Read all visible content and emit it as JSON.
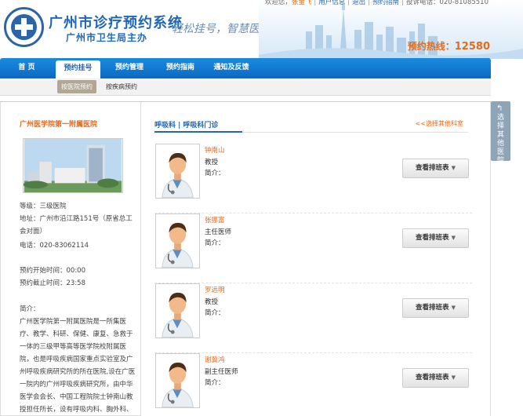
{
  "header": {
    "site_title": "广州市诊疗预约系统",
    "site_subtitle": "广州市卫生局主办",
    "slogan": "轻松挂号，智慧医疗",
    "welcome_prefix": "欢迎您，",
    "user_name": "张金飞",
    "links": [
      "用户信息",
      "退出",
      "预约指南"
    ],
    "complaint_phone": "投诉电话：020-81085510",
    "hotline_label": "预约热线：",
    "hotline_number": "12580"
  },
  "nav": {
    "items": [
      "首 页",
      "预约挂号",
      "预约管理",
      "预约指南",
      "通知及反馈"
    ],
    "active_index": 1
  },
  "subnav": {
    "items": [
      "按医院预约",
      "按疾病预约"
    ],
    "active_index": 0
  },
  "hospital": {
    "name": "广州医学院第一附属医院",
    "grade": "等级：三级医院",
    "address_line1": "地址：广州市沿江路151号（原省总工",
    "address_line2": "会对面）",
    "phone": "电话：020-83062114",
    "open_time": "预约开始时间：00:00",
    "close_time": "预约截止时间：23:58",
    "intro_label": "简介：",
    "intro_text": "广州医学院第一附属医院是一所集医疗、教学、科研、保健、康复、急救于一体的三级甲等高等医学院校附属医院，也是呼吸疾病国家重点实验室及广州呼吸疾病研究所的所在医院,设在广医一院内的广州呼吸疾病研究所，由中华医学会会长、中国工程院院士钟南山教授担任所长，设有呼吸内科、胸外科、"
  },
  "department": {
    "name": "呼吸科",
    "sub_name": "呼吸科门诊",
    "separator": "|",
    "other_link": "<<选择其他科室"
  },
  "doctors": [
    {
      "name": "钟南山",
      "title": "教授",
      "intro_label": "简介：",
      "button": "查看排班表"
    },
    {
      "name": "张挪富",
      "title": "主任医师",
      "intro_label": "简介：",
      "button": "查看排班表"
    },
    {
      "name": "罗远明",
      "title": "教授",
      "intro_label": "简介：",
      "button": "查看排班表"
    },
    {
      "name": "谢冀鸿",
      "title": "副主任医师",
      "intro_label": "简介：",
      "button": "查看排班表"
    }
  ],
  "side_tab": {
    "label": "选择其他医院"
  },
  "colors": {
    "brand_blue": "#1f67b7",
    "accent_orange": "#e46b1c",
    "nav_blue": "#0b69c2"
  }
}
